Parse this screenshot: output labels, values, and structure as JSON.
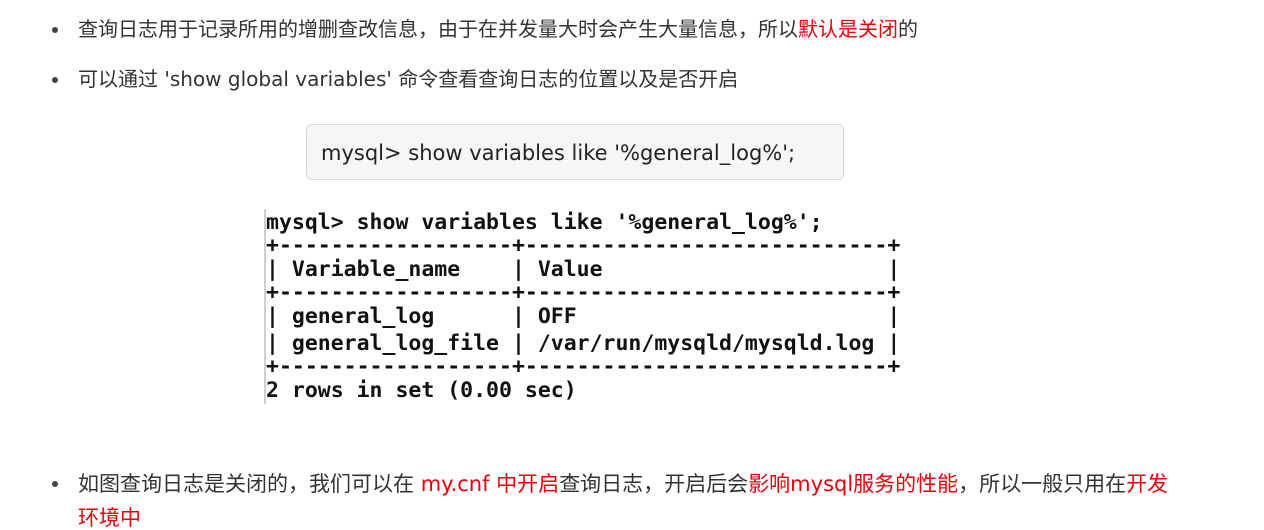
{
  "bullets": [
    {
      "parts": [
        {
          "text": "查询日志用于记录所用的增删查改信息，由于在并发量大时会产生大量信息，所以",
          "red": false
        },
        {
          "text": "默认是关闭",
          "red": true
        },
        {
          "text": "的",
          "red": false
        }
      ]
    },
    {
      "parts": [
        {
          "text": "可以通过 'show global variables' 命令查看查询日志的位置以及是否开启",
          "red": false
        }
      ]
    }
  ],
  "code_box": {
    "text": "mysql> show variables like '%general_log%';"
  },
  "terminal": {
    "lines": [
      "mysql> show variables like '%general_log%';",
      "+------------------+----------------------------+",
      "| Variable_name    | Value                      |",
      "+------------------+----------------------------+",
      "| general_log      | OFF                        |",
      "| general_log_file | /var/run/mysqld/mysqld.log |",
      "+------------------+----------------------------+",
      "2 rows in set (0.00 sec)"
    ]
  },
  "bottom_bullet": {
    "parts": [
      {
        "text": "如图查询日志是关闭的，我们可以在 ",
        "red": false
      },
      {
        "text": "my.cnf 中开启",
        "red": true
      },
      {
        "text": "查询日志，开启后会",
        "red": false
      },
      {
        "text": "影响mysql服务的性能",
        "red": true
      },
      {
        "text": "，所以一般只用在",
        "red": false
      },
      {
        "text": "开发",
        "red": true
      }
    ],
    "cut_text": "环境中"
  }
}
